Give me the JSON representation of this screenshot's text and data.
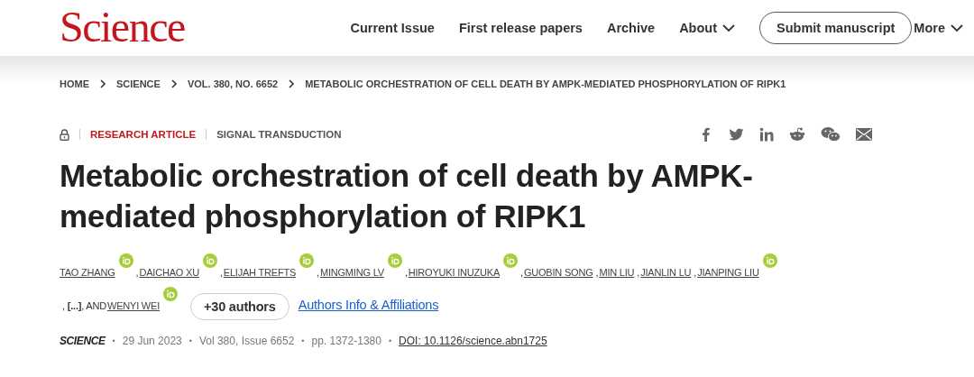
{
  "header": {
    "logo": "Science",
    "nav": [
      {
        "label": "Current Issue",
        "dropdown": false
      },
      {
        "label": "First release papers",
        "dropdown": false
      },
      {
        "label": "Archive",
        "dropdown": false
      },
      {
        "label": "About",
        "dropdown": true
      }
    ],
    "submit_button": "Submit manuscript",
    "more": {
      "label": "More",
      "dropdown": true
    }
  },
  "breadcrumb": [
    "HOME",
    "SCIENCE",
    "VOL. 380, NO. 6652",
    "METABOLIC ORCHESTRATION OF CELL DEATH BY AMPK-MEDIATED PHOSPHORYLATION OF RIPK1"
  ],
  "article": {
    "locked": true,
    "type": "RESEARCH ARTICLE",
    "topic": "SIGNAL TRANSDUCTION",
    "share": [
      {
        "kind": "facebook"
      },
      {
        "kind": "twitter"
      },
      {
        "kind": "linkedin"
      },
      {
        "kind": "reddit"
      },
      {
        "kind": "wechat"
      },
      {
        "kind": "email"
      }
    ],
    "title": "Metabolic orchestration of cell death by AMPK-mediated phosphorylation of RIPK1",
    "authors": [
      {
        "name": "TAO ZHANG",
        "orcid": true,
        "suffix": ","
      },
      {
        "name": "DAICHAO XU",
        "orcid": true,
        "suffix": ","
      },
      {
        "name": "ELIJAH TREFTS",
        "orcid": true,
        "suffix": ","
      },
      {
        "name": "MINGMING LV",
        "orcid": true,
        "suffix": ","
      },
      {
        "name": "HIROYUKI INUZUKA",
        "orcid": true,
        "suffix": ","
      },
      {
        "name": "GUOBIN SONG",
        "orcid": false,
        "suffix": ","
      },
      {
        "name": "MIN LIU",
        "orcid": false,
        "suffix": ","
      },
      {
        "name": "JIANLIN LU",
        "orcid": false,
        "suffix": ","
      },
      {
        "name": "JIANPING LIU",
        "orcid": true,
        "suffix": ", **[...]**, AND"
      },
      {
        "name": "WENYI WEI",
        "orcid": true
      }
    ],
    "more_authors": "+30 authors",
    "affiliations_link": "Authors Info & Affiliations",
    "meta": [
      {
        "kind": "journal",
        "text": "SCIENCE"
      },
      {
        "kind": "dot",
        "text": "•"
      },
      {
        "kind": "plain",
        "text": "29 Jun 2023"
      },
      {
        "kind": "dot",
        "text": "•"
      },
      {
        "kind": "plain",
        "text": "Vol 380, Issue 6652"
      },
      {
        "kind": "dot",
        "text": "•"
      },
      {
        "kind": "plain",
        "text": "pp. 1372-1380"
      },
      {
        "kind": "dot",
        "text": "•"
      },
      {
        "kind": "link",
        "text": "DOI: 10.1126/science.abn1725"
      }
    ]
  }
}
